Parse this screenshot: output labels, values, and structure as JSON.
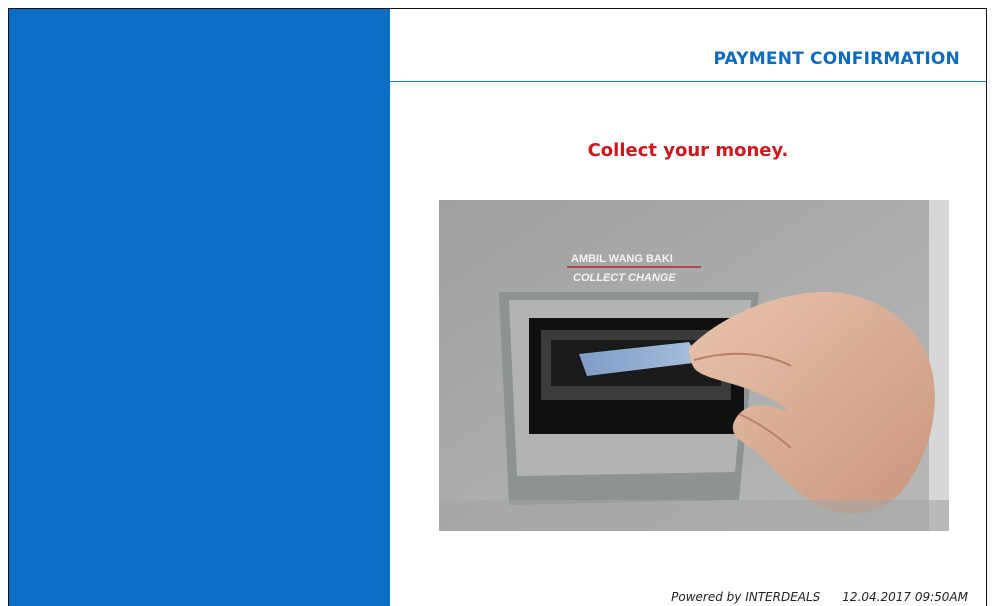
{
  "header": {
    "title": "PAYMENT CONFIRMATION"
  },
  "main": {
    "message": "Collect your money.",
    "message_color": "#d2161c",
    "photo": {
      "label_top": "AMBIL WANG BAKI",
      "label_bottom": "COLLECT CHANGE"
    }
  },
  "footer": {
    "powered_by": "Powered by INTERDEALS",
    "date": "12.04.2017",
    "time": "09:50AM"
  },
  "colors": {
    "brand_blue": "#0c6ec6",
    "title_blue": "#0f6bbf"
  }
}
